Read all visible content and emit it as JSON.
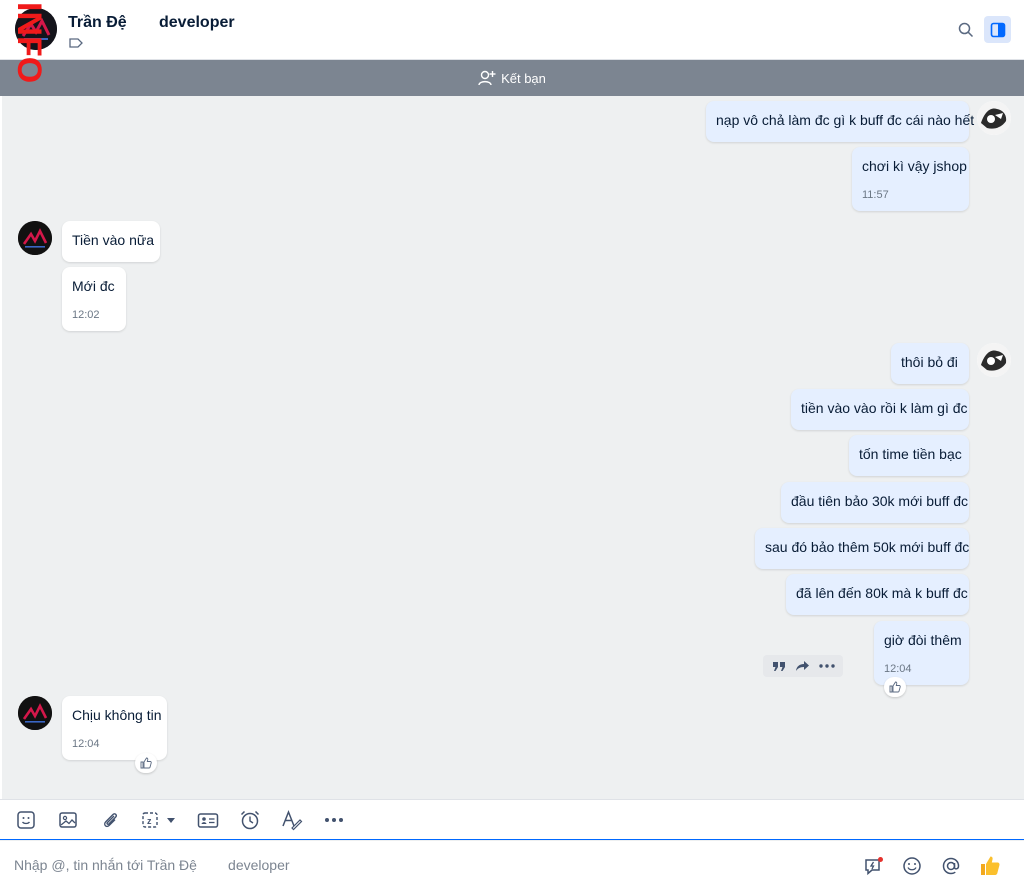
{
  "header": {
    "name": "Trần Đệ",
    "role": "developer",
    "watermark": "INFO"
  },
  "friend_bar": {
    "label": "Kết bạn"
  },
  "messages": [
    {
      "side": "out",
      "text": "nạp vô chả làm đc gì k buff đc cái nào hết"
    },
    {
      "side": "out",
      "text": "chơi kì vậy jshop",
      "time": "11:57"
    },
    {
      "side": "in",
      "text": "Tiền vào nữa"
    },
    {
      "side": "in",
      "text": "Mới đc",
      "time": "12:02"
    },
    {
      "side": "out",
      "text": "thôi bỏ đi"
    },
    {
      "side": "out",
      "text": "tiền vào vào rồi k làm gì đc"
    },
    {
      "side": "out",
      "text": "tốn time tiền bạc"
    },
    {
      "side": "out",
      "text": "đầu tiên bảo 30k mới buff đc"
    },
    {
      "side": "out",
      "text": "sau đó bảo thêm 50k mới buff đc"
    },
    {
      "side": "out",
      "text": "đã lên đến 80k mà k buff đc"
    },
    {
      "side": "out",
      "text": "giờ đòi thêm",
      "time": "12:04"
    },
    {
      "side": "in",
      "text": "Chịu không tin",
      "time": "12:04"
    }
  ],
  "composer": {
    "placeholder": "Nhập @, tin nhắn tới Trần Đệ        developer"
  },
  "colors": {
    "accent": "#0068ff",
    "outgoing_bubble": "#e5efff",
    "incoming_bubble": "#ffffff",
    "friend_bar": "#7c8591"
  }
}
